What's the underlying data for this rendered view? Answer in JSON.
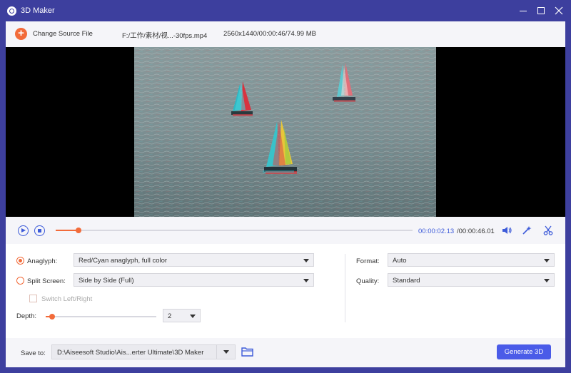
{
  "window": {
    "title": "3D Maker",
    "accent_color": "#3d3f9e"
  },
  "source": {
    "change_label": "Change Source File",
    "file_name": "F:/工作/素材/视...-30fps.mp4",
    "file_info": "2560x1440/00:00:46/74.99 MB"
  },
  "playback": {
    "current_time": "00:00:02.13",
    "total_time": "/00:00:46.01",
    "progress_fraction": 0.063
  },
  "settings": {
    "anaglyph_label": "Anaglyph:",
    "anaglyph_value": "Red/Cyan anaglyph, full color",
    "split_label": "Split Screen:",
    "split_value": "Side by Side (Full)",
    "switch_label": "Switch Left/Right",
    "depth_label": "Depth:",
    "depth_value": "2",
    "depth_fraction": 0.06,
    "format_label": "Format:",
    "format_value": "Auto",
    "quality_label": "Quality:",
    "quality_value": "Standard"
  },
  "output": {
    "save_label": "Save to:",
    "save_path": "D:\\Aiseesoft Studio\\Ais...erter Ultimate\\3D Maker",
    "generate_label": "Generate 3D"
  },
  "colors": {
    "accent_orange": "#f26b3a",
    "accent_blue": "#4a5be8"
  }
}
